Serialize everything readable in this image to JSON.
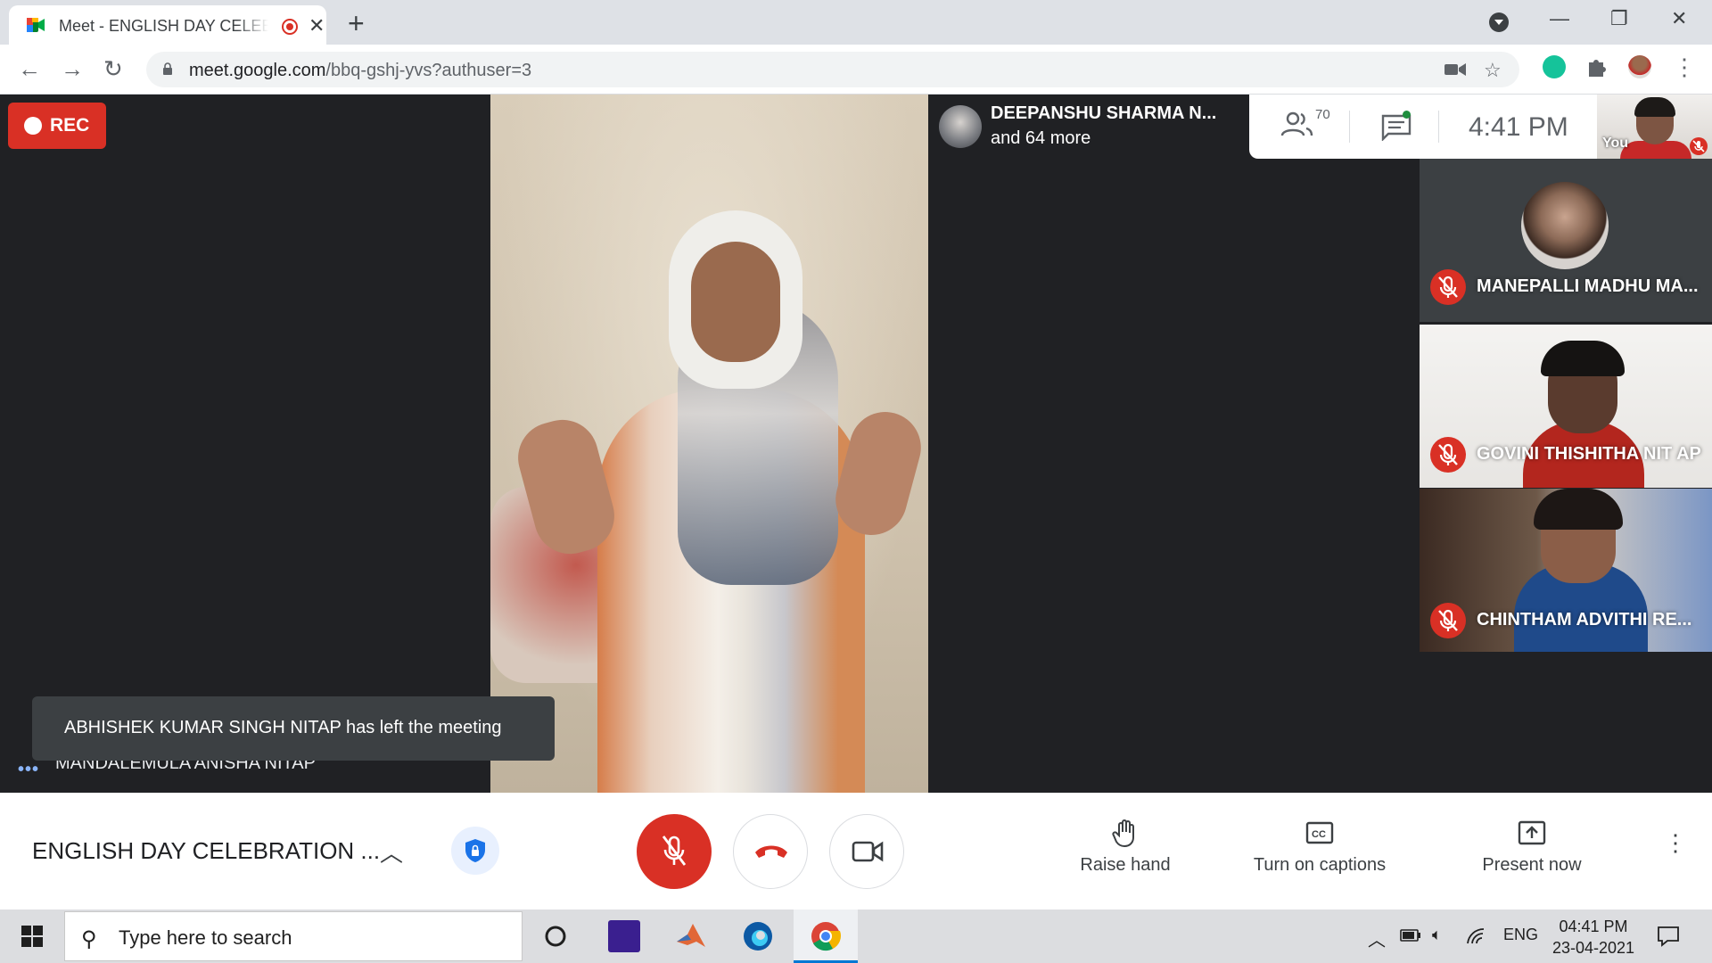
{
  "browser": {
    "tab_title": "Meet - ENGLISH DAY CELEBRATION",
    "tab_close": "✕",
    "new_tab": "+",
    "url_host": "meet.google.com",
    "url_path": "/bbq-gshj-yvs?authuser=3",
    "window_controls": {
      "minimize": "—",
      "restore": "❐",
      "close": "✕"
    }
  },
  "meet": {
    "rec_label": "REC",
    "speaker_name": "MANDALEMULA ANISHA NITAP",
    "speaking_indicator": "•••",
    "toast": "ABHISHEK KUMAR SINGH NITAP has left the meeting",
    "presenting_name": "DEEPANSHU SHARMA N...",
    "presenting_more": "and 64 more",
    "participants_count": "70",
    "clock": "4:41  PM",
    "self_label": "You",
    "tiles": [
      {
        "name": "MANEPALLI MADHU MA..."
      },
      {
        "name": "GOVINI THISHITHA NIT AP"
      },
      {
        "name": "CHINTHAM ADVITHI RE..."
      }
    ]
  },
  "controls": {
    "meeting_title": "ENGLISH DAY CELEBRATION ...",
    "raise_hand": "Raise hand",
    "captions": "Turn on captions",
    "present": "Present now",
    "more": "⋮"
  },
  "taskbar": {
    "search_placeholder": "Type here to search",
    "language": "ENG",
    "time": "04:41 PM",
    "date": "23-04-2021"
  },
  "colors": {
    "meet_red": "#d93025",
    "meet_dark": "#202124",
    "accent_blue": "#1a73e8",
    "taskbar": "#dcdde0"
  }
}
